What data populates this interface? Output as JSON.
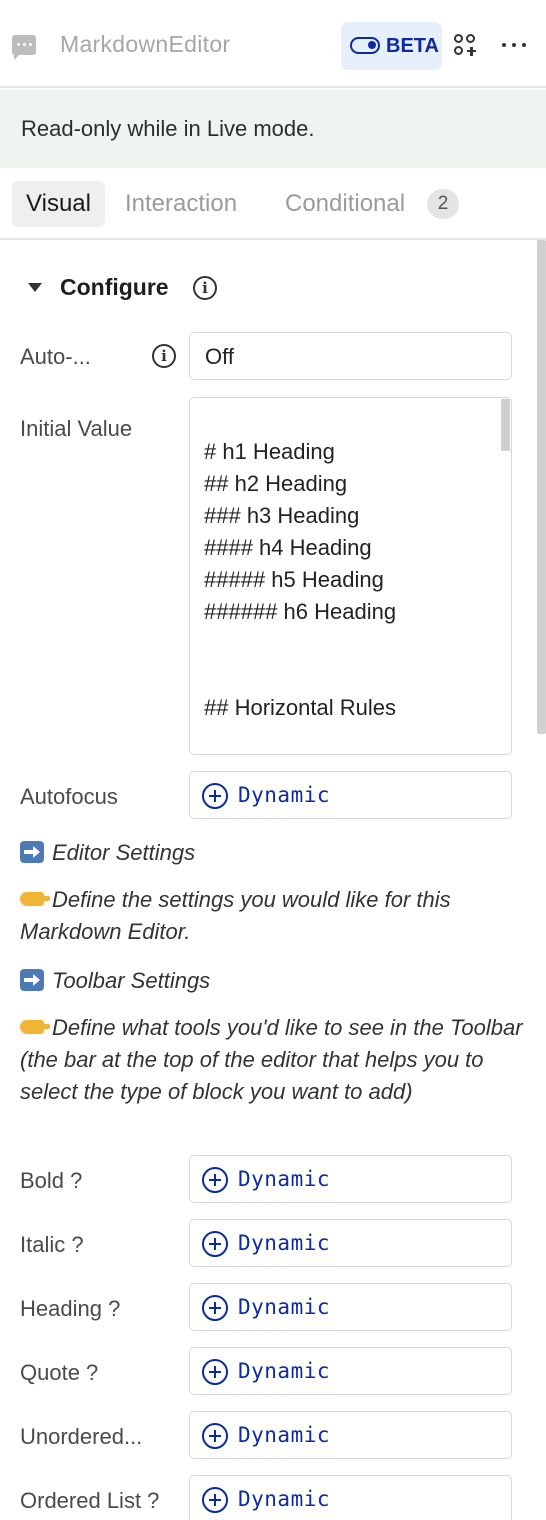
{
  "header": {
    "title": "MarkdownEditor",
    "beta_label": "BETA",
    "icons": [
      "chat-bubble-icon",
      "toggle-icon",
      "shapes-icon",
      "more-icon"
    ]
  },
  "banner": {
    "text": "Read-only while in Live mode."
  },
  "tabs": [
    {
      "label": "Visual",
      "active": true
    },
    {
      "label": "Interaction",
      "active": false
    },
    {
      "label": "Conditional",
      "active": false,
      "count": "2"
    }
  ],
  "configure": {
    "title": "Configure",
    "auto": {
      "label": "Auto-...",
      "value": "Off"
    },
    "initial_value": {
      "label": "Initial Value",
      "lines": [
        "# h1 Heading",
        "## h2 Heading",
        "### h3 Heading",
        "#### h4 Heading",
        "##### h5 Heading",
        "###### h6 Heading",
        "## Horizontal Rules"
      ]
    },
    "autofocus": {
      "label": "Autofocus",
      "value": "Dynamic"
    },
    "editor_settings": {
      "heading": "Editor Settings",
      "description": "Define the settings you would like for this Markdown Editor."
    },
    "toolbar_settings": {
      "heading": "Toolbar Settings",
      "description": "Define what tools you'd like to see in the Toolbar (the bar at the top of the editor that helps you to select the type of block you want to add)"
    },
    "toolbar_items": [
      {
        "label": "Bold ?",
        "value": "Dynamic"
      },
      {
        "label": "Italic ?",
        "value": "Dynamic"
      },
      {
        "label": "Heading ?",
        "value": "Dynamic"
      },
      {
        "label": "Quote ?",
        "value": "Dynamic"
      },
      {
        "label": "Unordered...",
        "value": "Dynamic"
      },
      {
        "label": "Ordered List ?",
        "value": "Dynamic"
      }
    ]
  },
  "colors": {
    "accent": "#0c2ba1",
    "banner_bg": "#eef5f0",
    "beta_bg": "#e7eefc"
  }
}
